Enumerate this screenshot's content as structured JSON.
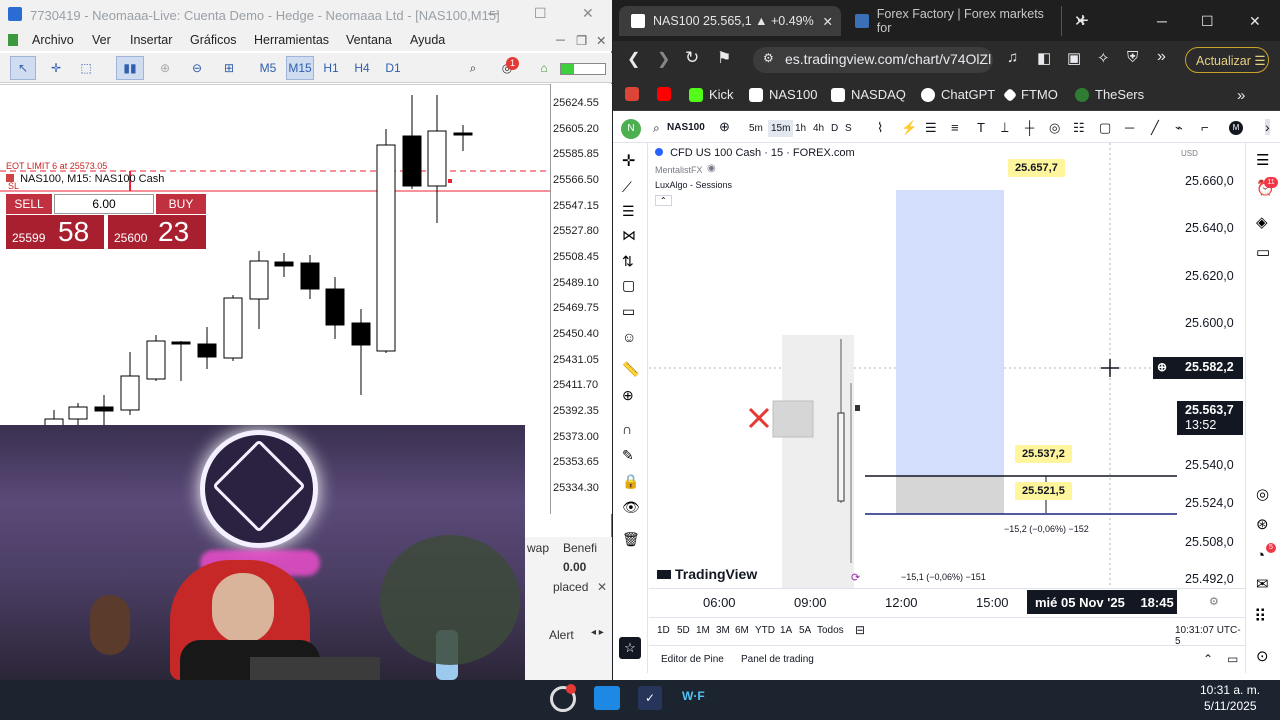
{
  "mt5": {
    "title": "7730419 - Neomaaa-Live: Cuenta Demo - Hedge - Neomaaa Ltd - [NAS100,M15]",
    "menu": [
      "Archivo",
      "Ver",
      "Insertar",
      "Gráficos",
      "Herramientas",
      "Ventana",
      "Ayuda"
    ],
    "timeframes": [
      "M5",
      "M15",
      "H1",
      "H4",
      "D1"
    ],
    "active_timeframe": "M15",
    "chart_header": "NAS100, M15:  NAS100 Cash",
    "one_click": {
      "sell_label": "SELL",
      "buy_label": "BUY",
      "volume": "6.00",
      "sell_small": "25599",
      "sell_big": "58",
      "buy_small": "25600",
      "buy_big": "23"
    },
    "line_labels": {
      "limit": "EOT LIMIT 6 at 25573.05",
      "sl": "SL"
    },
    "price_scale": [
      "25624.55",
      "25605.20",
      "25585.85",
      "25566.50",
      "25547.15",
      "25527.80",
      "25508.45",
      "25489.10",
      "25469.75",
      "25450.40",
      "25431.05",
      "25411.70",
      "25392.35",
      "25373.00",
      "25353.65",
      "25334.30"
    ],
    "bottom_panel": {
      "col1": "wap",
      "col2": "Benefi",
      "value": "0.00",
      "placed": "placed",
      "alerts": "Alert"
    },
    "notification_badge": "1"
  },
  "browser": {
    "tabs": [
      {
        "label": "NAS100 25.565,1 ▲ +0.49%",
        "active": true
      },
      {
        "label": "Forex Factory | Forex markets for",
        "active": false
      }
    ],
    "url": "es.tradingview.com/chart/v74OlZl",
    "update_button": "Actualizar",
    "bookmarks": [
      "Kick",
      "NAS100",
      "NASDAQ",
      "ChatGPT",
      "FTMO",
      "TheSers"
    ],
    "bookmark_colors": [
      "#db4437",
      "#ff0000",
      "#53fc18",
      "#ffffff",
      "#ffffff",
      "#ffffff",
      "#2e7d32"
    ]
  },
  "tradingview": {
    "symbol": "NAS100",
    "intervals": [
      "5m",
      "15m",
      "1h",
      "4h",
      "D",
      "S"
    ],
    "active_interval": "15m",
    "legend_title": "CFD US 100 Cash · 15 · FOREX.com",
    "legend_author": "MentalistFX",
    "legend_indicator": "LuxAlgo - Sessions",
    "currency": "USD",
    "price_scale": [
      "25.660,0",
      "25.640,0",
      "25.620,0",
      "25.600,0",
      "25.540,0",
      "25.524,0",
      "25.508,0",
      "25.492,0"
    ],
    "crosshair_price": "25.582,2",
    "last_price": "25.563,7",
    "countdown": "13:52",
    "labels": {
      "target": "25.657,7",
      "entry": "25.537,2",
      "stop": "25.521,5"
    },
    "stats": {
      "upper": "−15,2 (−0,06%) −152",
      "lower": "−15,1 (−0,06%) −151"
    },
    "time_axis": [
      "06:00",
      "09:00",
      "12:00",
      "15:00"
    ],
    "time_cursor": "mié 05 Nov '25",
    "time_cursor_hour": "18:45",
    "ranges": [
      "1D",
      "5D",
      "1M",
      "3M",
      "6M",
      "YTD",
      "1A",
      "5A",
      "Todos"
    ],
    "clock": "10:31:07 UTC-5",
    "bottom_tabs": [
      "Editor de Pine",
      "Panel de trading"
    ],
    "brand": "TradingView",
    "alert_badge": "11",
    "notif_badge": "5"
  },
  "taskbar": {
    "time": "10:31 a. m.",
    "date": "5/11/2025"
  },
  "colors": {
    "tv_blue": "#2962ff",
    "position_blue": "#d3defc",
    "position_gray": "#d6d6d6",
    "yellow": "#fff59d",
    "mt_red": "#c0303f"
  }
}
